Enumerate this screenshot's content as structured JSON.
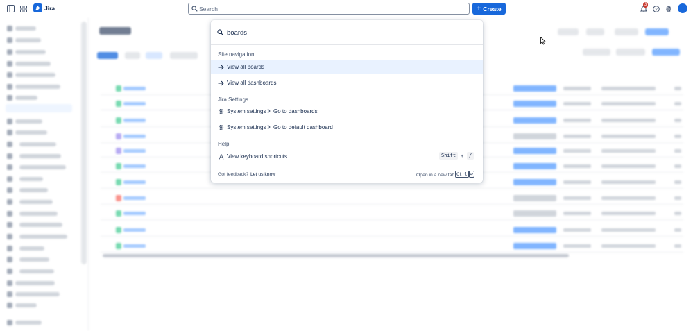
{
  "topbar": {
    "brand": "Jira",
    "search_placeholder": "Search",
    "create_label": "Create",
    "notification_count": "3"
  },
  "search_dropdown": {
    "query": "boards",
    "sections": [
      {
        "heading": "Site navigation",
        "items": [
          {
            "label": "View all boards",
            "icon": "arrow-right-icon",
            "active": true
          },
          {
            "label": "View all dashboards",
            "icon": "arrow-right-icon",
            "active": false
          }
        ]
      },
      {
        "heading": "Jira Settings",
        "items": [
          {
            "label": "System settings",
            "target": "Go to dashboards",
            "icon": "gear-icon"
          },
          {
            "label": "System settings",
            "target": "Go to default dashboard",
            "icon": "gear-icon"
          }
        ]
      },
      {
        "heading": "Help",
        "items": [
          {
            "label": "View keyboard shortcuts",
            "icon": "keyboard-icon",
            "shortcut": [
              "Shift",
              "+",
              "/"
            ]
          }
        ]
      }
    ],
    "footer": {
      "feedback_text": "Got feedback?",
      "feedback_link": "Let us know",
      "open_new_tab_text": "Open in a new tab",
      "key_ctrl": "Ctrl",
      "key_enter": "↩"
    }
  },
  "colors": {
    "brand_blue": "#1868db",
    "highlight": "#e9f2ff",
    "text": "#172b4d",
    "subtle_text": "#44546f",
    "badge_red": "#c9372c"
  }
}
